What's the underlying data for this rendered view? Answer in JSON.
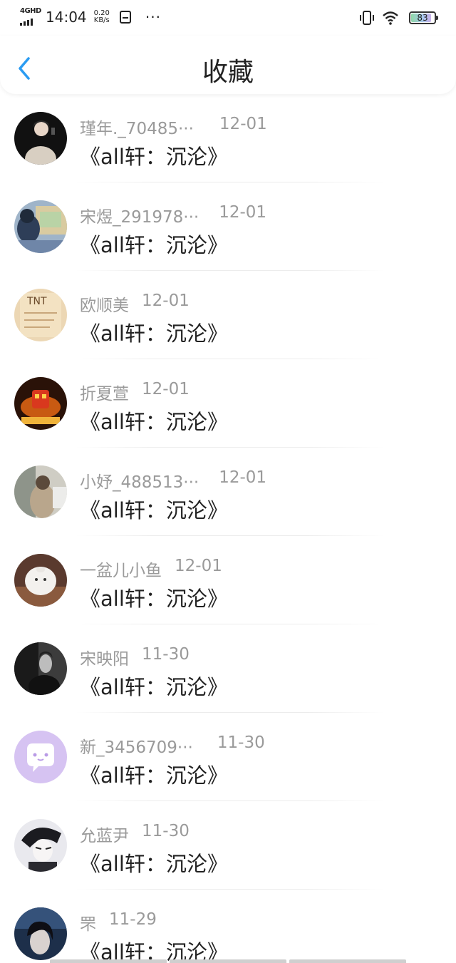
{
  "status_bar": {
    "network": "4GHD",
    "time": "14:04",
    "speed_value": "0.20",
    "speed_unit": "KB/s",
    "more": "···",
    "battery_level": "83"
  },
  "header": {
    "title": "收藏",
    "accent_color": "#2b9cf2"
  },
  "favorites": [
    {
      "user": "瑾年._70485···",
      "date": "12-01",
      "title": "《all轩：沉沦》",
      "avatar": "photo-dark"
    },
    {
      "user": "宋煜_291978···",
      "date": "12-01",
      "title": "《all轩：沉沦》",
      "avatar": "photo-blue"
    },
    {
      "user": "欧顺美",
      "date": "12-01",
      "title": "《all轩：沉沦》",
      "avatar": "photo-tan"
    },
    {
      "user": "折夏萱",
      "date": "12-01",
      "title": "《all轩：沉沦》",
      "avatar": "photo-orange"
    },
    {
      "user": "小妤_488513···",
      "date": "12-01",
      "title": "《all轩：沉沦》",
      "avatar": "photo-grey"
    },
    {
      "user": "一盆儿小鱼",
      "date": "12-01",
      "title": "《all轩：沉沦》",
      "avatar": "photo-toy"
    },
    {
      "user": "宋映阳",
      "date": "11-30",
      "title": "《all轩：沉沦》",
      "avatar": "photo-bw"
    },
    {
      "user": "新_3456709···",
      "date": "11-30",
      "title": "《all轩：沉沦》",
      "avatar": "default-chat"
    },
    {
      "user": "允蓝尹",
      "date": "11-30",
      "title": "《all轩：沉沦》",
      "avatar": "photo-sketch"
    },
    {
      "user": "罘",
      "date": "11-29",
      "title": "《all轩：沉沦》",
      "avatar": "photo-portrait"
    }
  ]
}
